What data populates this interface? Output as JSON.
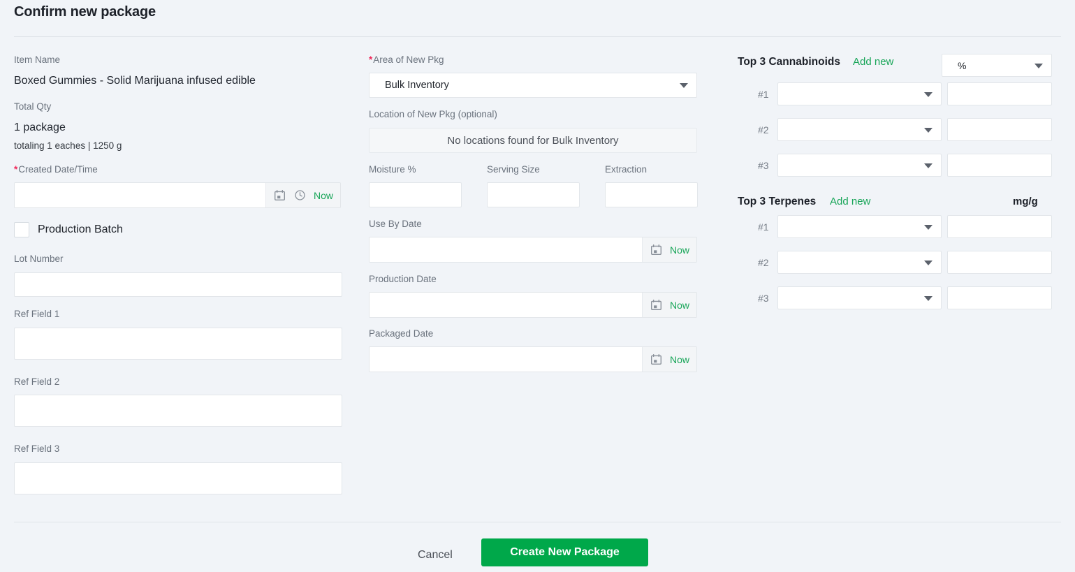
{
  "header": {
    "title": "Confirm new package"
  },
  "left": {
    "item_name_label": "Item Name",
    "item_name_value": "Boxed Gummies - Solid Marijuana infused edible",
    "total_qty_label": "Total Qty",
    "total_qty_value": "1 package",
    "total_qty_sub": "totaling 1 eaches | 1250 g",
    "created_label": "Created Date/Time",
    "created_value": "",
    "created_now": "Now",
    "production_batch_label": "Production Batch",
    "production_batch_checked": false,
    "lot_number_label": "Lot Number",
    "lot_number_value": "",
    "ref1_label": "Ref Field 1",
    "ref1_value": "",
    "ref2_label": "Ref Field 2",
    "ref2_value": "",
    "ref3_label": "Ref Field 3",
    "ref3_value": ""
  },
  "middle": {
    "area_label": "Area of New Pkg",
    "area_value": "Bulk Inventory",
    "location_label": "Location of New Pkg (optional)",
    "location_empty_text": "No locations found for Bulk Inventory",
    "moisture_label": "Moisture %",
    "moisture_value": "",
    "serving_label": "Serving Size",
    "serving_value": "",
    "extraction_label": "Extraction",
    "extraction_value": "",
    "use_by_label": "Use By Date",
    "use_by_value": "",
    "use_by_now": "Now",
    "production_date_label": "Production Date",
    "production_date_value": "",
    "production_date_now": "Now",
    "packaged_date_label": "Packaged Date",
    "packaged_date_value": "",
    "packaged_date_now": "Now"
  },
  "right": {
    "cannabinoids": {
      "title": "Top 3 Cannabinoids",
      "add_new": "Add new",
      "unit_value": "%",
      "rows": [
        {
          "num": "#1",
          "name": "",
          "amount": ""
        },
        {
          "num": "#2",
          "name": "",
          "amount": ""
        },
        {
          "num": "#3",
          "name": "",
          "amount": ""
        }
      ]
    },
    "terpenes": {
      "title": "Top 3 Terpenes",
      "add_new": "Add new",
      "unit_label": "mg/g",
      "rows": [
        {
          "num": "#1",
          "name": "",
          "amount": ""
        },
        {
          "num": "#2",
          "name": "",
          "amount": ""
        },
        {
          "num": "#3",
          "name": "",
          "amount": ""
        }
      ]
    }
  },
  "footer": {
    "cancel_label": "Cancel",
    "submit_label": "Create New Package"
  },
  "colors": {
    "accent_green": "#00a84a",
    "link_green": "#18a558",
    "required_red": "#f0285a",
    "background": "#f1f4f8"
  }
}
